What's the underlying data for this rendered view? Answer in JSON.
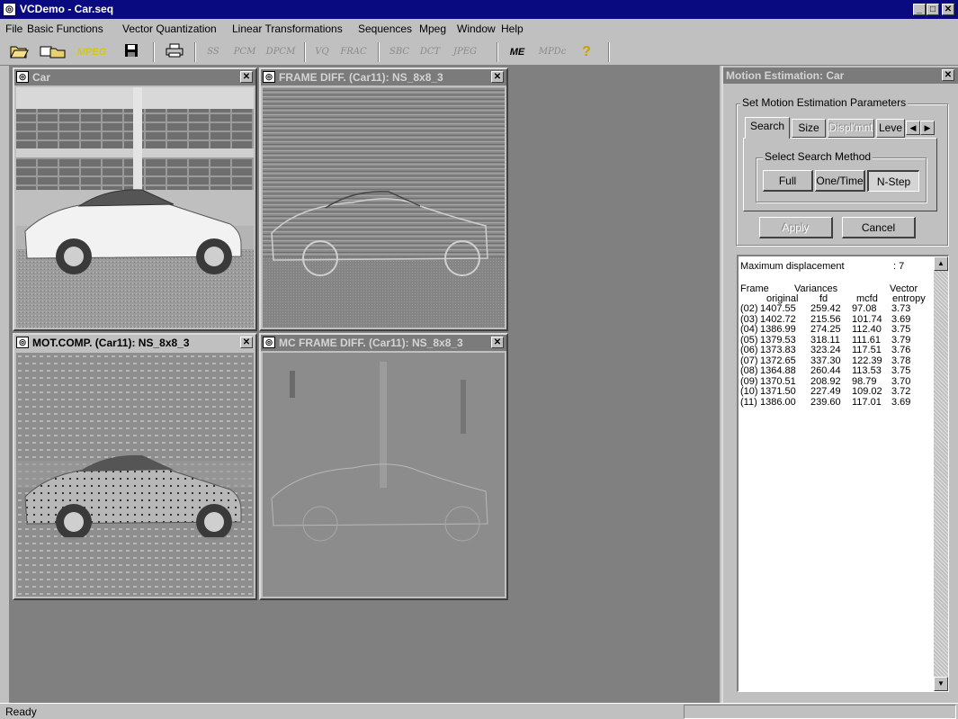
{
  "app": {
    "title": "VCDemo - Car.seq",
    "icon": "vcdemo-app-icon"
  },
  "menu": [
    "File",
    "Basic Functions",
    "Vector Quantization",
    "Linear Transformations",
    "Sequences",
    "Mpeg",
    "Window",
    "Help"
  ],
  "toolbar": {
    "tools": [
      "SS",
      "PCM",
      "DPCM",
      "VQ",
      "FRAC",
      "SBC",
      "DCT",
      "JPEG",
      "ME",
      "MPDc"
    ],
    "mpeg_label": "MPEG",
    "help_glyph": "?"
  },
  "windows": {
    "car": {
      "title": "Car"
    },
    "frame_diff": {
      "title": "FRAME DIFF. (Car11): NS_8x8_3"
    },
    "mot_comp": {
      "title": "MOT.COMP. (Car11): NS_8x8_3"
    },
    "mc_frame_diff": {
      "title": "MC FRAME DIFF. (Car11): NS_8x8_3"
    }
  },
  "motion_panel": {
    "title": "Motion Estimation: Car",
    "group_title": "Set Motion Estimation Parameters",
    "tabs": [
      "Search",
      "Size",
      "Displ'mnt",
      "Leve"
    ],
    "search_group_title": "Select Search Method",
    "methods": [
      "Full",
      "One/Time",
      "N-Step"
    ],
    "selected_method": "N-Step",
    "apply_label": "Apply",
    "cancel_label": "Cancel"
  },
  "results": {
    "max_disp_label": "Maximum displacement",
    "max_disp_value": ": 7",
    "header1": {
      "frame": "Frame",
      "variances": "Variances",
      "vector": "Vector"
    },
    "header2": {
      "original": "original",
      "fd": "fd",
      "mcfd": "mcfd",
      "entropy": "entropy"
    },
    "rows": [
      {
        "frame": "(02)",
        "original": "1407.55",
        "fd": "259.42",
        "mcfd": "97.08",
        "entropy": "3.73"
      },
      {
        "frame": "(03)",
        "original": "1402.72",
        "fd": "215.56",
        "mcfd": "101.74",
        "entropy": "3.69"
      },
      {
        "frame": "(04)",
        "original": "1386.99",
        "fd": "274.25",
        "mcfd": "112.40",
        "entropy": "3.75"
      },
      {
        "frame": "(05)",
        "original": "1379.53",
        "fd": "318.11",
        "mcfd": "111.61",
        "entropy": "3.79"
      },
      {
        "frame": "(06)",
        "original": "1373.83",
        "fd": "323.24",
        "mcfd": "117.51",
        "entropy": "3.76"
      },
      {
        "frame": "(07)",
        "original": "1372.65",
        "fd": "337.30",
        "mcfd": "122.39",
        "entropy": "3.78"
      },
      {
        "frame": "(08)",
        "original": "1364.88",
        "fd": "260.44",
        "mcfd": "113.53",
        "entropy": "3.75"
      },
      {
        "frame": "(09)",
        "original": "1370.51",
        "fd": "208.92",
        "mcfd": "98.79",
        "entropy": "3.70"
      },
      {
        "frame": "(10)",
        "original": "1371.50",
        "fd": "227.49",
        "mcfd": "109.02",
        "entropy": "3.72"
      },
      {
        "frame": "(11)",
        "original": "1386.00",
        "fd": "239.60",
        "mcfd": "117.01",
        "entropy": "3.69"
      }
    ]
  },
  "status": {
    "text": "Ready"
  }
}
